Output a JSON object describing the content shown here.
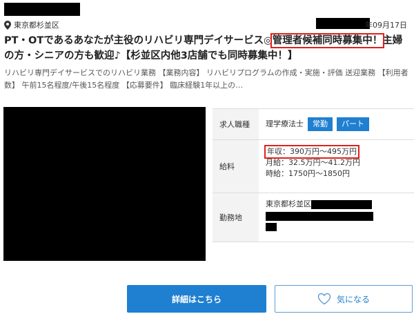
{
  "header": {
    "location_text": "東京都杉並区",
    "date_suffix": "年09月17日"
  },
  "title": {
    "part1": "PT・OTであるあなたが主役のリハビリ専門デイサービス◎",
    "highlight": "管理者候補同時募集中！",
    "part2": "主婦の方・シニアの方も歓迎♪【杉並区内他3店舗でも同時募集中！】"
  },
  "description": "リハビリ専門デイサービスでのリハビリ業務 【業務内容】 リハビリプログラムの作成・実施・評価 送迎業務 【利用者数】 午前15名程度/午後15名程度 【応募要件】 臨床経験1年以上の…",
  "info": {
    "job_label": "求人職種",
    "job_value": "理学療法士",
    "tags": [
      "常勤",
      "パート"
    ],
    "salary_label": "給料",
    "salary_annual": "年収：390万円〜495万円",
    "salary_monthly": "月給：32.5万円〜41.2万円",
    "salary_hourly": "時給：1750円〜1850円",
    "location_label": "勤務地",
    "location_value": "東京都杉並区"
  },
  "buttons": {
    "detail": "詳細はこちら",
    "favorite": "気になる"
  },
  "icons": {
    "location": "map-pin-icon",
    "favorite": "heart-icon"
  },
  "colors": {
    "accent": "#1f7fd1",
    "highlight_border": "#e0201b"
  }
}
